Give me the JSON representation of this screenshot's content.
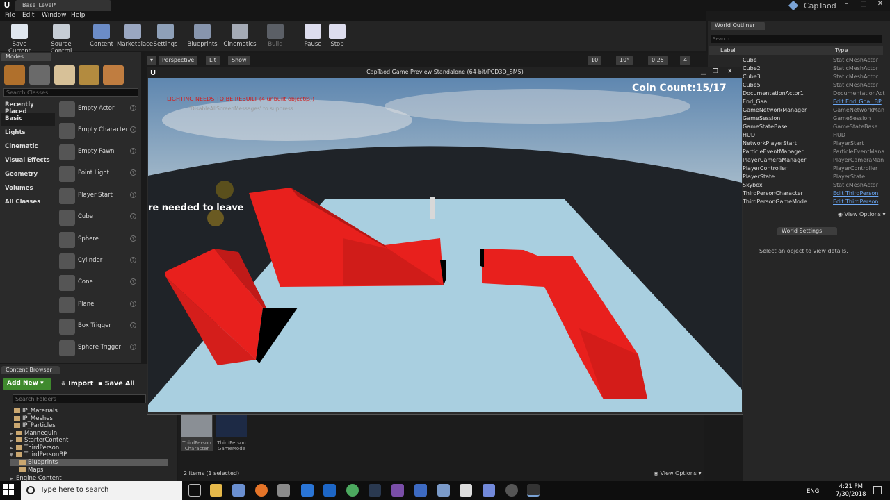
{
  "window": {
    "doc_tab": "Base_Level*",
    "user": "CapTaod"
  },
  "menu": [
    "File",
    "Edit",
    "Window",
    "Help"
  ],
  "toolbar": [
    "Save Current",
    "Source Control",
    "Content",
    "Marketplace",
    "Settings",
    "Blueprints",
    "Cinematics",
    "Build",
    "Pause",
    "Stop"
  ],
  "modes": {
    "tab": "Modes",
    "search_placeholder": "Search Classes",
    "categories": [
      "Recently Placed",
      "Basic",
      "Lights",
      "Cinematic",
      "Visual Effects",
      "Geometry",
      "Volumes",
      "All Classes"
    ],
    "items": [
      "Empty Actor",
      "Empty Character",
      "Empty Pawn",
      "Point Light",
      "Player Start",
      "Cube",
      "Sphere",
      "Cylinder",
      "Cone",
      "Plane",
      "Box Trigger",
      "Sphere Trigger"
    ]
  },
  "viewport": {
    "perspective": "Perspective",
    "lit": "Lit",
    "show": "Show",
    "grid": "10",
    "rot": "10°",
    "scale": "0.25",
    "cams": "4"
  },
  "content_browser": {
    "tab": "Content Browser",
    "add_new": "Add New",
    "import": "Import",
    "save_all": "Save All",
    "search_placeholder": "Search Folders",
    "folders": [
      "IP_Materials",
      "IP_Meshes",
      "IP_Particles",
      "Mannequin",
      "StarterContent",
      "ThirdPerson",
      "ThirdPersonBP",
      "Blueprints",
      "Maps",
      "Engine Content"
    ],
    "assets": [
      {
        "line1": "ThirdPerson",
        "line2": "Character"
      },
      {
        "line1": "ThirdPerson",
        "line2": "GameMode"
      }
    ],
    "status": "2 items (1 selected)",
    "view_options": "View Options"
  },
  "outliner": {
    "tab": "World Outliner",
    "search_placeholder": "Search",
    "col_label": "Label",
    "col_type": "Type",
    "rows": [
      [
        "Cube",
        "StaticMeshActor",
        false
      ],
      [
        "Cube2",
        "StaticMeshActor",
        false
      ],
      [
        "Cube3",
        "StaticMeshActor",
        false
      ],
      [
        "Cube5",
        "StaticMeshActor",
        false
      ],
      [
        "DocumentationActor1",
        "DocumentationAct",
        false
      ],
      [
        "End_Gaal",
        "Edit End_Goal_BP",
        true
      ],
      [
        "GameNetworkManager",
        "GameNetworkMan",
        false
      ],
      [
        "GameSession",
        "GameSession",
        false
      ],
      [
        "GameStateBase",
        "GameStateBase",
        false
      ],
      [
        "HUD",
        "HUD",
        false
      ],
      [
        "NetworkPlayerStart",
        "PlayerStart",
        false
      ],
      [
        "ParticleEventManager",
        "ParticleEventMana",
        false
      ],
      [
        "PlayerCameraManager",
        "PlayerCameraMan",
        false
      ],
      [
        "PlayerController",
        "PlayerController",
        false
      ],
      [
        "PlayerState",
        "PlayerState",
        false
      ],
      [
        "Skybox",
        "StaticMeshActor",
        false
      ],
      [
        "ThirdPersonCharacter",
        "Edit ThirdPerson",
        true
      ],
      [
        "ThirdPersonGameMode",
        "Edit ThirdPerson",
        true
      ]
    ],
    "view_options": "View Options"
  },
  "world_settings": {
    "tab": "World Settings",
    "message": "Select an object to view details."
  },
  "game": {
    "title": "CapTaod Game Preview Standalone (64-bit/PCD3D_SM5)",
    "coin": "Coin Count:15/17",
    "rebuild": "LIGHTING NEEDS TO BE REBUILT (4 unbuilt object(s))",
    "suppress": "'DisableAllScreenMessages' to suppress",
    "needed": "re needed to leave"
  },
  "taskbar": {
    "search": "Type here to search",
    "time": "4:21 PM",
    "date": "7/30/2018",
    "lang": "ENG"
  },
  "colors": {
    "accent_green": "#3f8a2e",
    "link": "#6aa7f5",
    "platform_red": "#e8201d",
    "floor": "#a9cfe0"
  }
}
